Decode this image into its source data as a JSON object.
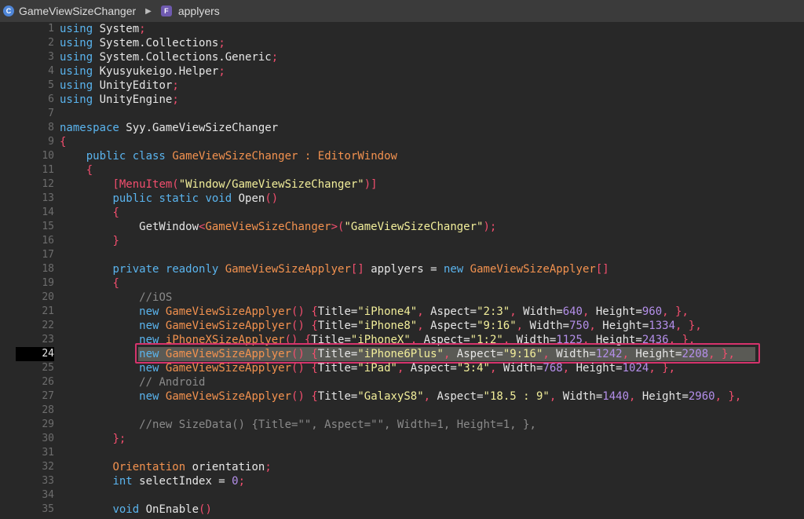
{
  "breadcrumb": {
    "project": "GameViewSizeChanger",
    "file": "applyers",
    "project_icon": "c-sharp-icon",
    "file_icon": "file-f-icon"
  },
  "current_line": 24,
  "lines": [
    {
      "n": "1",
      "t": [
        [
          "kw",
          "using"
        ],
        [
          "id",
          " System"
        ],
        [
          "punc",
          ";"
        ]
      ]
    },
    {
      "n": "2",
      "t": [
        [
          "kw",
          "using"
        ],
        [
          "id",
          " System.Collections"
        ],
        [
          "punc",
          ";"
        ]
      ]
    },
    {
      "n": "3",
      "t": [
        [
          "kw",
          "using"
        ],
        [
          "id",
          " System.Collections.Generic"
        ],
        [
          "punc",
          ";"
        ]
      ]
    },
    {
      "n": "4",
      "t": [
        [
          "kw",
          "using"
        ],
        [
          "id",
          " Kyusyukeigo.Helper"
        ],
        [
          "punc",
          ";"
        ]
      ]
    },
    {
      "n": "5",
      "t": [
        [
          "kw",
          "using"
        ],
        [
          "id",
          " UnityEditor"
        ],
        [
          "punc",
          ";"
        ]
      ]
    },
    {
      "n": "6",
      "t": [
        [
          "kw",
          "using"
        ],
        [
          "id",
          " UnityEngine"
        ],
        [
          "punc",
          ";"
        ]
      ]
    },
    {
      "n": "7",
      "t": []
    },
    {
      "n": "8",
      "t": [
        [
          "kw",
          "namespace"
        ],
        [
          "id",
          " Syy.GameViewSizeChanger"
        ]
      ]
    },
    {
      "n": "9",
      "t": [
        [
          "punc",
          "{"
        ]
      ]
    },
    {
      "n": "10",
      "t": [
        [
          "id",
          "    "
        ],
        [
          "kw",
          "public class"
        ],
        [
          "id",
          " "
        ],
        [
          "ty",
          "GameViewSizeChanger"
        ],
        [
          "id",
          " "
        ],
        [
          "ty",
          ":"
        ],
        [
          "id",
          " "
        ],
        [
          "ty",
          "EditorWindow"
        ]
      ]
    },
    {
      "n": "11",
      "t": [
        [
          "id",
          "    "
        ],
        [
          "punc",
          "{"
        ]
      ]
    },
    {
      "n": "12",
      "t": [
        [
          "id",
          "        "
        ],
        [
          "attr",
          "[MenuItem("
        ],
        [
          "str",
          "\"Window/GameViewSizeChanger\""
        ],
        [
          "attr",
          ")]"
        ]
      ]
    },
    {
      "n": "13",
      "t": [
        [
          "id",
          "        "
        ],
        [
          "kw",
          "public static void"
        ],
        [
          "id",
          " Open"
        ],
        [
          "punc",
          "()"
        ]
      ]
    },
    {
      "n": "14",
      "t": [
        [
          "id",
          "        "
        ],
        [
          "punc",
          "{"
        ]
      ]
    },
    {
      "n": "15",
      "t": [
        [
          "id",
          "            GetWindow"
        ],
        [
          "punc",
          "<"
        ],
        [
          "ty",
          "GameViewSizeChanger"
        ],
        [
          "punc",
          ">("
        ],
        [
          "str",
          "\"GameViewSizeChanger\""
        ],
        [
          "punc",
          ");"
        ]
      ]
    },
    {
      "n": "16",
      "t": [
        [
          "id",
          "        "
        ],
        [
          "punc",
          "}"
        ]
      ]
    },
    {
      "n": "17",
      "t": []
    },
    {
      "n": "18",
      "t": [
        [
          "id",
          "        "
        ],
        [
          "kw",
          "private"
        ],
        [
          "id",
          " "
        ],
        [
          "kw",
          "readonly"
        ],
        [
          "id",
          " "
        ],
        [
          "ty",
          "GameViewSizeApplyer"
        ],
        [
          "punc",
          "[]"
        ],
        [
          "id",
          " applyers = "
        ],
        [
          "kw",
          "new"
        ],
        [
          "id",
          " "
        ],
        [
          "ty",
          "GameViewSizeApplyer"
        ],
        [
          "punc",
          "[]"
        ]
      ]
    },
    {
      "n": "19",
      "t": [
        [
          "id",
          "        "
        ],
        [
          "punc",
          "{"
        ]
      ]
    },
    {
      "n": "20",
      "t": [
        [
          "id",
          "            "
        ],
        [
          "cm",
          "//iOS"
        ]
      ]
    },
    {
      "n": "21",
      "t": [
        [
          "id",
          "            "
        ],
        [
          "kw",
          "new"
        ],
        [
          "id",
          " "
        ],
        [
          "ty",
          "GameViewSizeApplyer"
        ],
        [
          "punc",
          "()"
        ],
        [
          "id",
          " "
        ],
        [
          "punc",
          "{"
        ],
        [
          "id",
          "Title="
        ],
        [
          "str",
          "\"iPhone4\""
        ],
        [
          "punc",
          ","
        ],
        [
          "id",
          " Aspect="
        ],
        [
          "str",
          "\"2:3\""
        ],
        [
          "punc",
          ","
        ],
        [
          "id",
          " Width="
        ],
        [
          "num",
          "640"
        ],
        [
          "punc",
          ","
        ],
        [
          "id",
          " Height="
        ],
        [
          "num",
          "960"
        ],
        [
          "punc",
          ","
        ],
        [
          "id",
          " "
        ],
        [
          "punc",
          "},"
        ]
      ]
    },
    {
      "n": "22",
      "t": [
        [
          "id",
          "            "
        ],
        [
          "kw",
          "new"
        ],
        [
          "id",
          " "
        ],
        [
          "ty",
          "GameViewSizeApplyer"
        ],
        [
          "punc",
          "()"
        ],
        [
          "id",
          " "
        ],
        [
          "punc",
          "{"
        ],
        [
          "id",
          "Title="
        ],
        [
          "str",
          "\"iPhone8\""
        ],
        [
          "punc",
          ","
        ],
        [
          "id",
          " Aspect="
        ],
        [
          "str",
          "\"9:16\""
        ],
        [
          "punc",
          ","
        ],
        [
          "id",
          " Width="
        ],
        [
          "num",
          "750"
        ],
        [
          "punc",
          ","
        ],
        [
          "id",
          " Height="
        ],
        [
          "num",
          "1334"
        ],
        [
          "punc",
          ","
        ],
        [
          "id",
          " "
        ],
        [
          "punc",
          "},"
        ]
      ]
    },
    {
      "n": "23",
      "t": [
        [
          "id",
          "            "
        ],
        [
          "kw",
          "new"
        ],
        [
          "id",
          " "
        ],
        [
          "ty",
          "iPhoneXSizeApplyer"
        ],
        [
          "punc",
          "()"
        ],
        [
          "id",
          " "
        ],
        [
          "punc",
          "{"
        ],
        [
          "id",
          "Title="
        ],
        [
          "str",
          "\"iPhoneX\""
        ],
        [
          "punc",
          ","
        ],
        [
          "id",
          " Aspect="
        ],
        [
          "str",
          "\"1:2\""
        ],
        [
          "punc",
          ","
        ],
        [
          "id",
          " Width="
        ],
        [
          "num",
          "1125"
        ],
        [
          "punc",
          ","
        ],
        [
          "id",
          " Height="
        ],
        [
          "num",
          "2436"
        ],
        [
          "punc",
          ","
        ],
        [
          "id",
          " "
        ],
        [
          "punc",
          "},"
        ]
      ]
    },
    {
      "n": "24",
      "t": [
        [
          "id",
          "            "
        ],
        [
          "kw",
          "new"
        ],
        [
          "id",
          " "
        ],
        [
          "ty",
          "GameViewSizeApplyer"
        ],
        [
          "punc",
          "()"
        ],
        [
          "id",
          " "
        ],
        [
          "punc",
          "{"
        ],
        [
          "id",
          "Title="
        ],
        [
          "str",
          "\"iPhone6Plus\""
        ],
        [
          "punc",
          ","
        ],
        [
          "id",
          " Aspect="
        ],
        [
          "str",
          "\"9:16\""
        ],
        [
          "punc",
          ","
        ],
        [
          "id",
          " Width="
        ],
        [
          "num",
          "1242"
        ],
        [
          "punc",
          ","
        ],
        [
          "id",
          " Height="
        ],
        [
          "num",
          "2208"
        ],
        [
          "punc",
          ","
        ],
        [
          "id",
          " "
        ],
        [
          "punc",
          "},"
        ]
      ]
    },
    {
      "n": "25",
      "t": [
        [
          "id",
          "            "
        ],
        [
          "kw",
          "new"
        ],
        [
          "id",
          " "
        ],
        [
          "ty",
          "GameViewSizeApplyer"
        ],
        [
          "punc",
          "()"
        ],
        [
          "id",
          " "
        ],
        [
          "punc",
          "{"
        ],
        [
          "id",
          "Title="
        ],
        [
          "str",
          "\"iPad\""
        ],
        [
          "punc",
          ","
        ],
        [
          "id",
          " Aspect="
        ],
        [
          "str",
          "\"3:4\""
        ],
        [
          "punc",
          ","
        ],
        [
          "id",
          " Width="
        ],
        [
          "num",
          "768"
        ],
        [
          "punc",
          ","
        ],
        [
          "id",
          " Height="
        ],
        [
          "num",
          "1024"
        ],
        [
          "punc",
          ","
        ],
        [
          "id",
          " "
        ],
        [
          "punc",
          "},"
        ]
      ]
    },
    {
      "n": "26",
      "t": [
        [
          "id",
          "            "
        ],
        [
          "cm",
          "// Android"
        ]
      ]
    },
    {
      "n": "27",
      "t": [
        [
          "id",
          "            "
        ],
        [
          "kw",
          "new"
        ],
        [
          "id",
          " "
        ],
        [
          "ty",
          "GameViewSizeApplyer"
        ],
        [
          "punc",
          "()"
        ],
        [
          "id",
          " "
        ],
        [
          "punc",
          "{"
        ],
        [
          "id",
          "Title="
        ],
        [
          "str",
          "\"GalaxyS8\""
        ],
        [
          "punc",
          ","
        ],
        [
          "id",
          " Aspect="
        ],
        [
          "str",
          "\"18.5 : 9\""
        ],
        [
          "punc",
          ","
        ],
        [
          "id",
          " Width="
        ],
        [
          "num",
          "1440"
        ],
        [
          "punc",
          ","
        ],
        [
          "id",
          " Height="
        ],
        [
          "num",
          "2960"
        ],
        [
          "punc",
          ","
        ],
        [
          "id",
          " "
        ],
        [
          "punc",
          "},"
        ]
      ]
    },
    {
      "n": "28",
      "t": []
    },
    {
      "n": "29",
      "t": [
        [
          "id",
          "            "
        ],
        [
          "cm",
          "//new SizeData() {Title=\"\", Aspect=\"\", Width=1, Height=1, },"
        ]
      ]
    },
    {
      "n": "30",
      "t": [
        [
          "id",
          "        "
        ],
        [
          "punc",
          "};"
        ]
      ]
    },
    {
      "n": "31",
      "t": []
    },
    {
      "n": "32",
      "t": [
        [
          "id",
          "        "
        ],
        [
          "ty",
          "Orientation"
        ],
        [
          "id",
          " orientation"
        ],
        [
          "punc",
          ";"
        ]
      ]
    },
    {
      "n": "33",
      "t": [
        [
          "id",
          "        "
        ],
        [
          "kw",
          "int"
        ],
        [
          "id",
          " selectIndex = "
        ],
        [
          "num",
          "0"
        ],
        [
          "punc",
          ";"
        ]
      ]
    },
    {
      "n": "34",
      "t": []
    },
    {
      "n": "35",
      "t": [
        [
          "id",
          "        "
        ],
        [
          "kw",
          "void"
        ],
        [
          "id",
          " OnEnable"
        ],
        [
          "punc",
          "()"
        ]
      ]
    }
  ]
}
